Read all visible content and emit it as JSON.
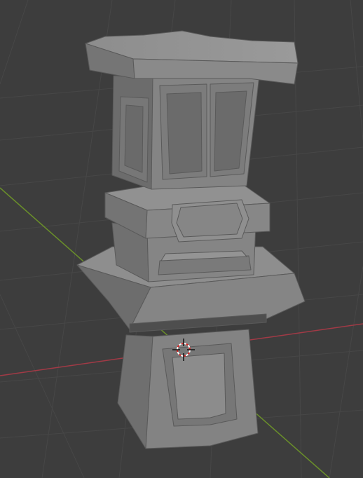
{
  "viewport": {
    "background": "#3d3d3d",
    "grid_color": "#4a4a4a",
    "x_axis_color": "#a13a46",
    "y_axis_color": "#6a8f2a",
    "mesh_color": "#8a8a8a"
  },
  "scene": {
    "object": "stone-lantern-mesh",
    "shading": "solid",
    "overlays": [
      "floor-grid",
      "x-axis-line",
      "y-axis-line",
      "3d-cursor"
    ]
  }
}
